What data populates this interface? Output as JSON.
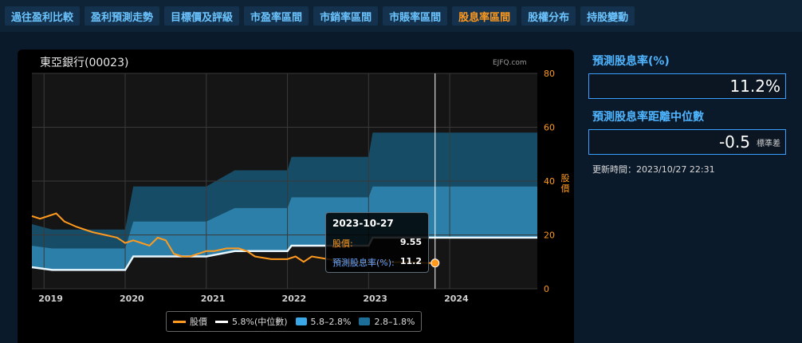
{
  "tabs": [
    {
      "label": "過往盈利比較",
      "active": false
    },
    {
      "label": "盈利預測走勢",
      "active": false
    },
    {
      "label": "目標價及評級",
      "active": false
    },
    {
      "label": "市盈率區間",
      "active": false
    },
    {
      "label": "市銷率區間",
      "active": false
    },
    {
      "label": "市賬率區間",
      "active": false
    },
    {
      "label": "股息率區間",
      "active": true
    },
    {
      "label": "股權分布",
      "active": false
    },
    {
      "label": "持股變動",
      "active": false
    }
  ],
  "chart": {
    "title": "東亞銀行(00023)",
    "watermark": "EJFQ.com",
    "y_axis_title": "股價",
    "tooltip": {
      "date": "2023-10-27",
      "price_label": "股價:",
      "price_value": "9.55",
      "yield_label": "預測股息率(%):",
      "yield_value": "11.2"
    },
    "legend": [
      {
        "label": "股價",
        "kind": "line",
        "color": "#ff9a1e"
      },
      {
        "label": "5.8%(中位數)",
        "kind": "line",
        "color": "#ffffff"
      },
      {
        "label": "5.8–2.8%",
        "kind": "box",
        "color": "#3aa8e6"
      },
      {
        "label": "2.8–1.8%",
        "kind": "box",
        "color": "#1d6e96"
      }
    ]
  },
  "chart_data": {
    "type": "area",
    "x_ticks": [
      "2019",
      "2020",
      "2021",
      "2022",
      "2023",
      "2024"
    ],
    "y_ticks": [
      "0",
      "20",
      "40",
      "60",
      "80"
    ],
    "ylim": [
      0,
      80
    ],
    "xlim": [
      2018.85,
      2025.08
    ],
    "crosshair_x": 2023.82,
    "series": [
      {
        "name": "股價",
        "x": [
          2018.85,
          2018.95,
          2019.05,
          2019.15,
          2019.25,
          2019.4,
          2019.5,
          2019.6,
          2019.75,
          2019.9,
          2020.0,
          2020.1,
          2020.2,
          2020.3,
          2020.4,
          2020.5,
          2020.6,
          2020.7,
          2020.8,
          2021.0,
          2021.1,
          2021.25,
          2021.4,
          2021.5,
          2021.6,
          2021.8,
          2022.0,
          2022.1,
          2022.2,
          2022.3,
          2022.5,
          2022.7,
          2022.8,
          2023.0,
          2023.1,
          2023.2,
          2023.3,
          2023.5,
          2023.7,
          2023.82
        ],
        "y": [
          27,
          26,
          27,
          28,
          25,
          23,
          22,
          21,
          20,
          19,
          17,
          18,
          17,
          16,
          19,
          18,
          13,
          12,
          12,
          14,
          14,
          15,
          15,
          14,
          12,
          11,
          11,
          12,
          10,
          12,
          11,
          10,
          9.5,
          10,
          9.2,
          10.5,
          9.8,
          10,
          9.6,
          9.55
        ]
      },
      {
        "name": "5.8%(中位數)",
        "step_x": [
          2018.85,
          2019.1,
          2020.0,
          2020.1,
          2021.0,
          2021.35,
          2022.0,
          2022.05,
          2023.0,
          2023.05,
          2025.08
        ],
        "y": [
          8,
          7,
          7,
          12,
          12,
          14,
          14,
          16,
          16,
          19,
          19
        ]
      },
      {
        "name": "5.8–2.8%",
        "step_x": [
          2018.85,
          2019.1,
          2020.0,
          2020.1,
          2021.0,
          2021.35,
          2022.0,
          2022.05,
          2023.0,
          2023.05,
          2025.08
        ],
        "y": [
          16,
          15,
          15,
          25,
          25,
          30,
          30,
          34,
          34,
          38,
          38
        ]
      },
      {
        "name": "2.8–1.8%",
        "step_x": [
          2018.85,
          2019.1,
          2020.0,
          2020.1,
          2021.0,
          2021.35,
          2022.0,
          2022.05,
          2023.0,
          2023.05,
          2025.08
        ],
        "y": [
          24,
          22,
          22,
          38,
          38,
          44,
          44,
          49,
          49,
          58,
          58
        ]
      }
    ]
  },
  "side": {
    "yield_label": "預測股息率(%)",
    "yield_value": "11.2%",
    "deviation_label": "預測股息率距離中位數",
    "deviation_value": "-0.5",
    "deviation_unit": "標準差",
    "updated": "更新時間：2023/10/27 22:31"
  },
  "colors": {
    "price": "#ff9a1e",
    "median": "#ffffff",
    "band_inner": "#2b7fa8",
    "band_outer": "#174c66",
    "accent": "#4fb5ff"
  }
}
